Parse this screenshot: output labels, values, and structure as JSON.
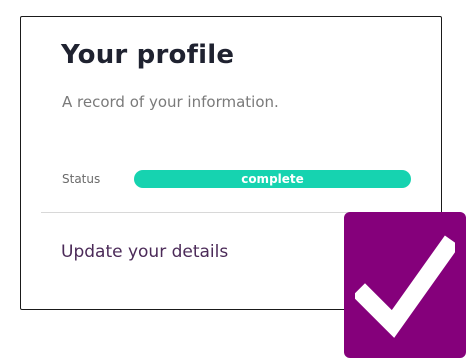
{
  "profile_card": {
    "title": "Your profile",
    "subtitle": "A record of your information.",
    "status": {
      "label": "Status",
      "value": "complete",
      "bar_color": "#16d3b0",
      "fill_percent": 100
    },
    "update_link": "Update your details"
  },
  "badge": {
    "icon": "checkmark-icon",
    "color": "#85007b"
  }
}
